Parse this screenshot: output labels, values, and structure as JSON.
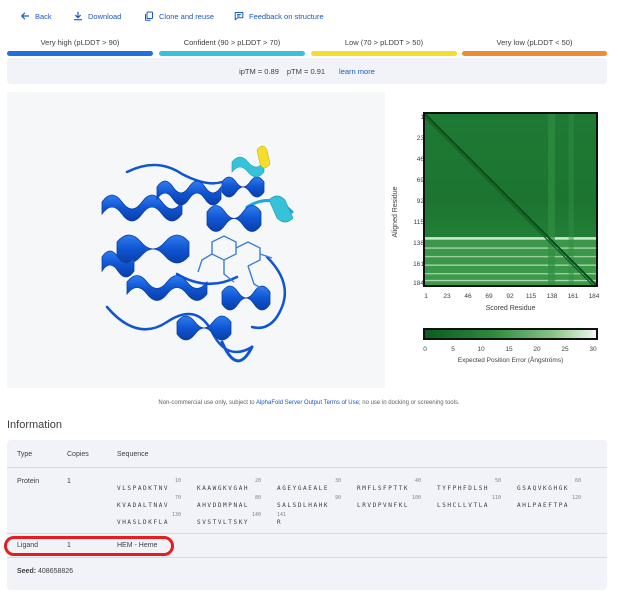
{
  "toolbar": {
    "back": "Back",
    "download": "Download",
    "clone": "Clone and reuse",
    "feedback": "Feedback on structure"
  },
  "confidence": [
    {
      "label": "Very high (pLDDT > 90)",
      "color": "#1f6fe0"
    },
    {
      "label": "Confident (90 > pLDDT > 70)",
      "color": "#36c3da"
    },
    {
      "label": "Low (70 > pLDDT > 50)",
      "color": "#f5de2b"
    },
    {
      "label": "Very low (pLDDT < 50)",
      "color": "#ef8a35"
    }
  ],
  "metrics": {
    "iptm": "ipTM = 0.89",
    "ptm": "pTM = 0.91",
    "learn_more": "learn more"
  },
  "pae": {
    "y_label": "Aligned Residue",
    "x_label": "Scored Residue",
    "y_ticks": [
      "1",
      "23",
      "46",
      "69",
      "92",
      "115",
      "138",
      "161",
      "184"
    ],
    "x_ticks": [
      "1",
      "23",
      "46",
      "69",
      "92",
      "115",
      "138",
      "161",
      "184"
    ],
    "colorbar_ticks": [
      "0",
      "5",
      "10",
      "15",
      "20",
      "25",
      "30"
    ],
    "colorbar_label": "Expected Position Error (Ångströms)"
  },
  "disclaimer": {
    "prefix": "Non-commercial use only, subject to",
    "link": "AlphaFold Server Output Terms of Use",
    "suffix": "; no use in docking or screening tools."
  },
  "information": {
    "title": "Information",
    "headers": {
      "type": "Type",
      "copies": "Copies",
      "sequence": "Sequence"
    },
    "protein": {
      "type": "Protein",
      "copies": "1",
      "lines": [
        {
          "nums": [
            "10",
            "20",
            "30",
            "40",
            "50",
            "60"
          ],
          "chunks": [
            "VLSPADKTNV",
            "KAAWGKVGAH",
            "AGEYGAEALE",
            "RMFLSFPTTK",
            "TYFPHFDLSH",
            "GSAQVKGHGK"
          ]
        },
        {
          "nums": [
            "70",
            "80",
            "90",
            "100",
            "110",
            "120"
          ],
          "chunks": [
            "KVADALTNAV",
            "AHVDDMPNAL",
            "SALSDLHAHK",
            "LRVDPVNFKL",
            "LSHCLLVTLA",
            "AHLPAEFTPA"
          ]
        },
        {
          "nums": [
            "130",
            "140",
            "141"
          ],
          "chunks": [
            "VHASLDKFLA",
            "SVSTVLTSKY",
            "R"
          ]
        }
      ]
    },
    "ligand": {
      "type": "Ligand",
      "copies": "1",
      "sequence": "HEM - Heme"
    },
    "seed": {
      "label": "Seed:",
      "value": "408658826"
    }
  }
}
